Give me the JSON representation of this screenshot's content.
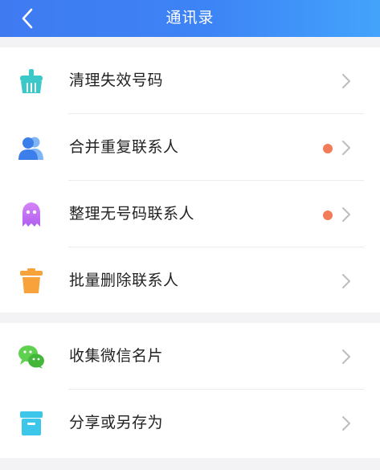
{
  "header": {
    "title": "通讯录"
  },
  "groups": [
    {
      "items": [
        {
          "label": "清理失效号码",
          "icon": "broom-icon",
          "color": "#3bc8c8",
          "badge": false
        },
        {
          "label": "合并重复联系人",
          "icon": "users-icon",
          "color": "#4a8cf0",
          "badge": true
        },
        {
          "label": "整理无号码联系人",
          "icon": "ghost-icon",
          "color": "#c06ff0",
          "badge": true
        },
        {
          "label": "批量删除联系人",
          "icon": "trash-icon",
          "color": "#f7a23a",
          "badge": false
        }
      ]
    },
    {
      "items": [
        {
          "label": "收集微信名片",
          "icon": "wechat-icon",
          "color": "#4fc84a",
          "badge": false
        },
        {
          "label": "分享或另存为",
          "icon": "archive-box-icon",
          "color": "#3cc6ea",
          "badge": false
        }
      ]
    }
  ],
  "colors": {
    "header_start": "#3f7af1",
    "header_end": "#43a3fb",
    "badge_dot": "#f27c58",
    "chevron": "#bdbdbd"
  }
}
